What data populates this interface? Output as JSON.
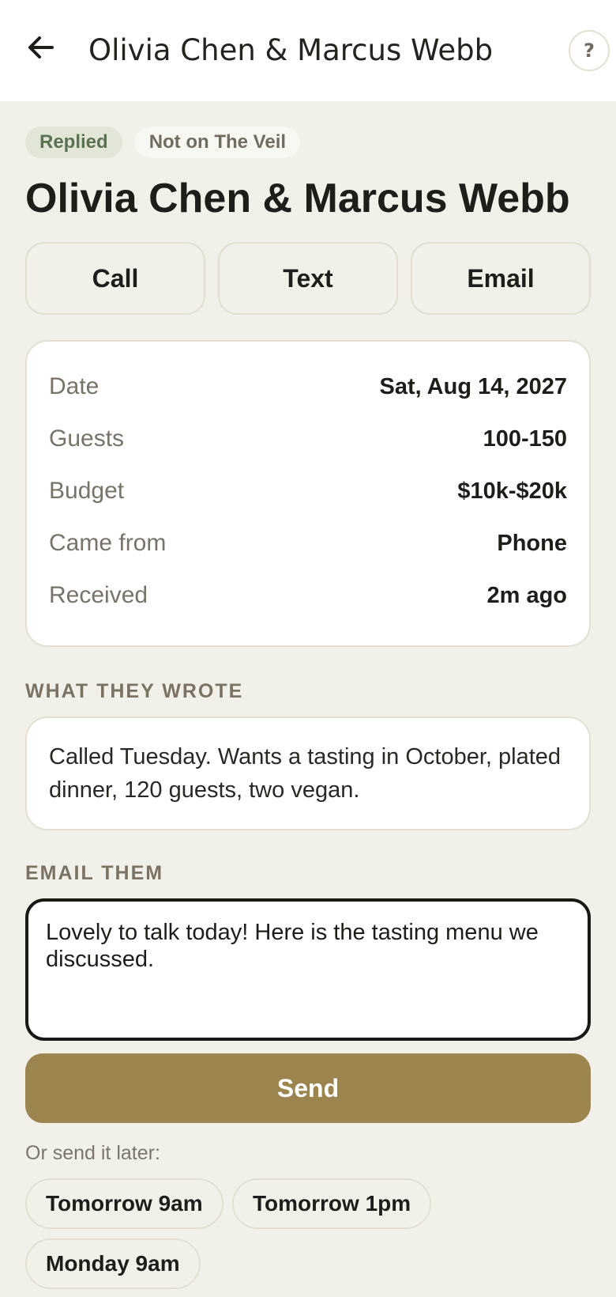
{
  "header": {
    "back_icon": "arrow-left-icon",
    "title": "Olivia Chen & Marcus Webb",
    "help_label": "?"
  },
  "badges": {
    "status": "Replied",
    "source": "Not on The Veil"
  },
  "lead": {
    "name": "Olivia Chen & Marcus Webb"
  },
  "actions": {
    "call": "Call",
    "text": "Text",
    "email": "Email"
  },
  "details": [
    {
      "label": "Date",
      "value": "Sat, Aug 14, 2027"
    },
    {
      "label": "Guests",
      "value": "100-150"
    },
    {
      "label": "Budget",
      "value": "$10k-$20k"
    },
    {
      "label": "Came from",
      "value": "Phone"
    },
    {
      "label": "Received",
      "value": "2m ago"
    }
  ],
  "wrote": {
    "heading": "WHAT THEY WROTE",
    "message": "Called Tuesday. Wants a tasting in October, plated dinner, 120 guests, two vegan."
  },
  "email": {
    "heading": "EMAIL THEM",
    "draft": "Lovely to talk today! Here is the tasting menu we discussed.",
    "send_label": "Send",
    "later_label": "Or send it later:",
    "schedule_options": [
      "Tomorrow 9am",
      "Tomorrow 1pm",
      "Monday 9am"
    ]
  },
  "colors": {
    "background": "#f1f1e9",
    "accent": "#9c844f",
    "replied_badge_bg": "#e1e6d6",
    "replied_badge_text": "#5a7152"
  }
}
